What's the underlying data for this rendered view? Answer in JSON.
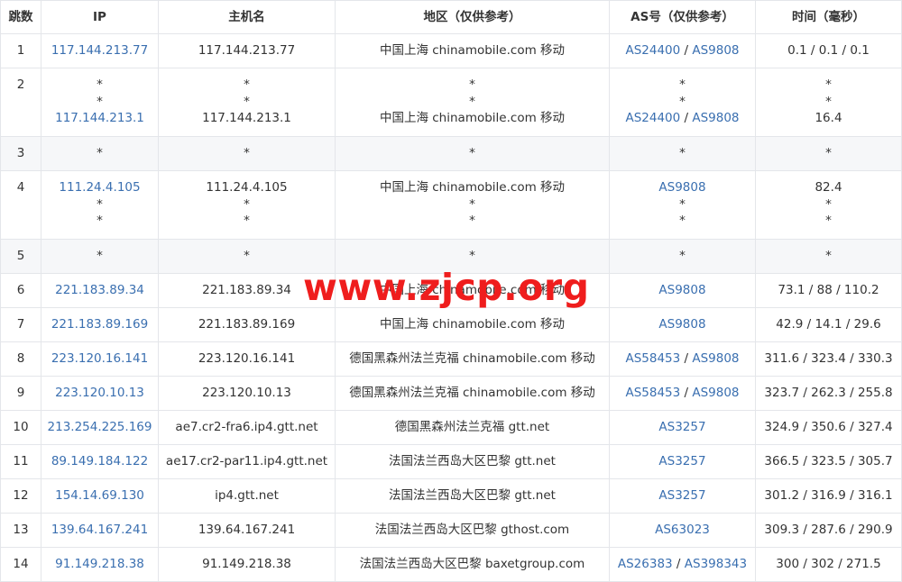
{
  "headers": [
    "跳数",
    "IP",
    "主机名",
    "地区（仅供参考）",
    "AS号（仅供参考）",
    "时间（毫秒）"
  ],
  "watermark": "www.zjcp.org",
  "rows": [
    {
      "hop": "1",
      "grey": false,
      "lines": [
        {
          "ip": "117.144.213.77",
          "host": "117.144.213.77",
          "region": "中国上海 chinamobile.com 移动",
          "as": [
            "AS24400",
            "AS9808"
          ],
          "time": "0.1 / 0.1 / 0.1"
        }
      ]
    },
    {
      "hop": "2",
      "grey": false,
      "lines": [
        {
          "ip": "*",
          "host": "*",
          "region": "*",
          "as": [
            "*"
          ],
          "time": "*"
        },
        {
          "ip": "*",
          "host": "*",
          "region": "*",
          "as": [
            "*"
          ],
          "time": "*"
        },
        {
          "ip": "117.144.213.1",
          "host": "117.144.213.1",
          "region": "中国上海 chinamobile.com 移动",
          "as": [
            "AS24400",
            "AS9808"
          ],
          "time": "16.4"
        }
      ]
    },
    {
      "hop": "3",
      "grey": true,
      "lines": [
        {
          "ip": "*",
          "host": "*",
          "region": "*",
          "as": [
            "*"
          ],
          "time": "*"
        }
      ]
    },
    {
      "hop": "4",
      "grey": false,
      "lines": [
        {
          "ip": "111.24.4.105",
          "host": "111.24.4.105",
          "region": "中国上海 chinamobile.com 移动",
          "as": [
            "AS9808"
          ],
          "time": "82.4"
        },
        {
          "ip": "*",
          "host": "*",
          "region": "*",
          "as": [
            "*"
          ],
          "time": "*"
        },
        {
          "ip": "*",
          "host": "*",
          "region": "*",
          "as": [
            "*"
          ],
          "time": "*"
        }
      ]
    },
    {
      "hop": "5",
      "grey": true,
      "lines": [
        {
          "ip": "*",
          "host": "*",
          "region": "*",
          "as": [
            "*"
          ],
          "time": "*"
        }
      ]
    },
    {
      "hop": "6",
      "grey": false,
      "lines": [
        {
          "ip": "221.183.89.34",
          "host": "221.183.89.34",
          "region": "中国上海 chinamobile.com 移动",
          "as": [
            "AS9808"
          ],
          "time": "73.1 / 88 / 110.2"
        }
      ]
    },
    {
      "hop": "7",
      "grey": false,
      "lines": [
        {
          "ip": "221.183.89.169",
          "host": "221.183.89.169",
          "region": "中国上海 chinamobile.com 移动",
          "as": [
            "AS9808"
          ],
          "time": "42.9 / 14.1 / 29.6"
        }
      ]
    },
    {
      "hop": "8",
      "grey": false,
      "lines": [
        {
          "ip": "223.120.16.141",
          "host": "223.120.16.141",
          "region": "德国黑森州法兰克福 chinamobile.com 移动",
          "as": [
            "AS58453",
            "AS9808"
          ],
          "time": "311.6 / 323.4 / 330.3"
        }
      ]
    },
    {
      "hop": "9",
      "grey": false,
      "lines": [
        {
          "ip": "223.120.10.13",
          "host": "223.120.10.13",
          "region": "德国黑森州法兰克福 chinamobile.com 移动",
          "as": [
            "AS58453",
            "AS9808"
          ],
          "time": "323.7 / 262.3 / 255.8"
        }
      ]
    },
    {
      "hop": "10",
      "grey": false,
      "lines": [
        {
          "ip": "213.254.225.169",
          "host": "ae7.cr2-fra6.ip4.gtt.net",
          "region": "德国黑森州法兰克福 gtt.net",
          "as": [
            "AS3257"
          ],
          "time": "324.9 / 350.6 / 327.4"
        }
      ]
    },
    {
      "hop": "11",
      "grey": false,
      "lines": [
        {
          "ip": "89.149.184.122",
          "host": "ae17.cr2-par11.ip4.gtt.net",
          "region": "法国法兰西岛大区巴黎 gtt.net",
          "as": [
            "AS3257"
          ],
          "time": "366.5 / 323.5 / 305.7"
        }
      ]
    },
    {
      "hop": "12",
      "grey": false,
      "lines": [
        {
          "ip": "154.14.69.130",
          "host": "ip4.gtt.net",
          "region": "法国法兰西岛大区巴黎 gtt.net",
          "as": [
            "AS3257"
          ],
          "time": "301.2 / 316.9 / 316.1"
        }
      ]
    },
    {
      "hop": "13",
      "grey": false,
      "lines": [
        {
          "ip": "139.64.167.241",
          "host": "139.64.167.241",
          "region": "法国法兰西岛大区巴黎 gthost.com",
          "as": [
            "AS63023"
          ],
          "time": "309.3 / 287.6 / 290.9"
        }
      ]
    },
    {
      "hop": "14",
      "grey": false,
      "lines": [
        {
          "ip": "91.149.218.38",
          "host": "91.149.218.38",
          "region": "法国法兰西岛大区巴黎 baxetgroup.com",
          "as": [
            "AS26383",
            "AS398343"
          ],
          "time": "300 / 302 / 271.5"
        }
      ]
    }
  ],
  "colors": {
    "link": "#3a6fb0",
    "grey_row": "#f6f7f9",
    "border": "#e4e6ea",
    "watermark": "#ef1d1d"
  }
}
